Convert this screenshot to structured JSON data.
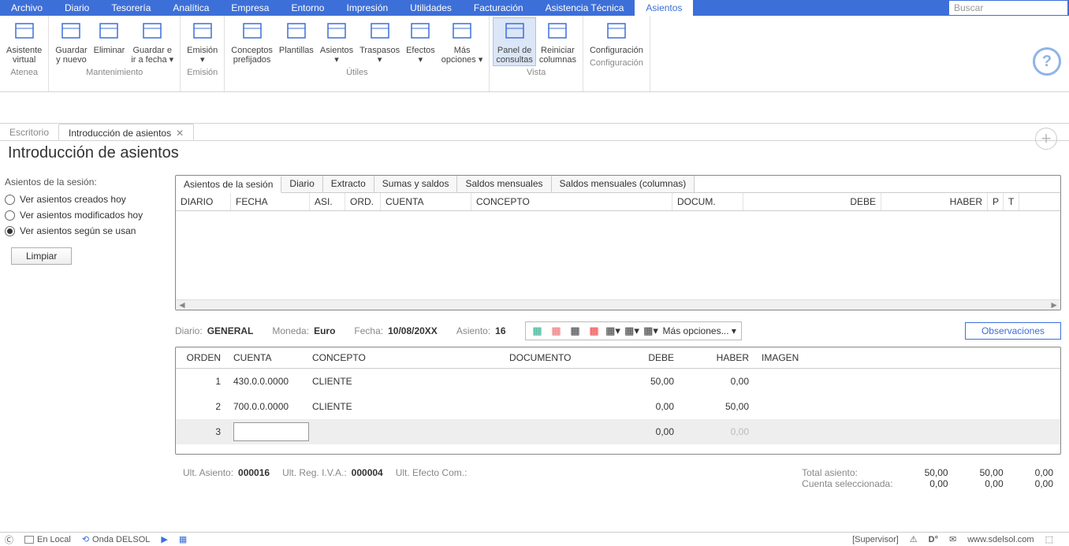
{
  "menu": {
    "items": [
      "Archivo",
      "Diario",
      "Tesorería",
      "Analítica",
      "Empresa",
      "Entorno",
      "Impresión",
      "Utilidades",
      "Facturación",
      "Asistencia Técnica",
      "Asientos"
    ],
    "active": 10,
    "search_placeholder": "Buscar"
  },
  "ribbon": {
    "groups": [
      {
        "label": "Atenea",
        "buttons": [
          {
            "lbl": "Asistente\nvirtual",
            "name": "asistente-virtual"
          }
        ]
      },
      {
        "label": "Mantenimiento",
        "buttons": [
          {
            "lbl": "Guardar\ny nuevo",
            "name": "guardar-y-nuevo"
          },
          {
            "lbl": "Eliminar",
            "name": "eliminar"
          },
          {
            "lbl": "Guardar e\nir a fecha ▾",
            "name": "guardar-ir-a-fecha"
          }
        ]
      },
      {
        "label": "Emisión",
        "buttons": [
          {
            "lbl": "Emisión\n▾",
            "name": "emision"
          }
        ]
      },
      {
        "label": "Útiles",
        "buttons": [
          {
            "lbl": "Conceptos\nprefijados",
            "name": "conceptos-prefijados"
          },
          {
            "lbl": "Plantillas",
            "name": "plantillas"
          },
          {
            "lbl": "Asientos\n▾",
            "name": "asientos"
          },
          {
            "lbl": "Traspasos\n▾",
            "name": "traspasos"
          },
          {
            "lbl": "Efectos\n▾",
            "name": "efectos"
          },
          {
            "lbl": "Más\nopciones ▾",
            "name": "mas-opciones"
          }
        ]
      },
      {
        "label": "Vista",
        "buttons": [
          {
            "lbl": "Panel de\nconsultas",
            "name": "panel-de-consultas",
            "active": true
          },
          {
            "lbl": "Reiniciar\ncolumnas",
            "name": "reiniciar-columnas"
          }
        ]
      },
      {
        "label": "Configuración",
        "buttons": [
          {
            "lbl": "Configuración",
            "name": "configuracion"
          }
        ]
      }
    ]
  },
  "workspace": {
    "tabs": [
      {
        "label": "Escritorio",
        "closable": false,
        "active": false
      },
      {
        "label": "Introducción de asientos",
        "closable": true,
        "active": true
      }
    ],
    "title": "Introducción de asientos"
  },
  "sidebar": {
    "heading": "Asientos de la sesión:",
    "radios": [
      {
        "label": "Ver asientos creados hoy",
        "checked": false
      },
      {
        "label": "Ver asientos modificados hoy",
        "checked": false
      },
      {
        "label": "Ver asientos según se usan",
        "checked": true
      }
    ],
    "clear_label": "Limpiar"
  },
  "subtabs": {
    "items": [
      "Asientos de la sesión",
      "Diario",
      "Extracto",
      "Sumas y saldos",
      "Saldos mensuales",
      "Saldos mensuales (columnas)"
    ],
    "active": 0
  },
  "upper_table": {
    "headers": [
      "DIARIO",
      "FECHA",
      "ASI.",
      "ORD.",
      "CUENTA",
      "CONCEPTO",
      "DOCUM.",
      "DEBE",
      "HABER",
      "P",
      "T"
    ]
  },
  "info": {
    "diario_k": "Diario:",
    "diario_v": "GENERAL",
    "moneda_k": "Moneda:",
    "moneda_v": "Euro",
    "fecha_k": "Fecha:",
    "fecha_v": "10/08/20XX",
    "asiento_k": "Asiento:",
    "asiento_v": "16",
    "mas_opciones": "Más opciones...  ▾",
    "observaciones": "Observaciones"
  },
  "entry_table": {
    "headers": [
      "ORDEN",
      "CUENTA",
      "CONCEPTO",
      "DOCUMENTO",
      "DEBE",
      "HABER",
      "IMAGEN"
    ],
    "rows": [
      {
        "orden": "1",
        "cuenta": "430.0.0.0000",
        "concepto": "CLIENTE",
        "documento": "",
        "debe": "50,00",
        "haber": "0,00",
        "imagen": ""
      },
      {
        "orden": "2",
        "cuenta": "700.0.0.0000",
        "concepto": "CLIENTE",
        "documento": "",
        "debe": "0,00",
        "haber": "50,00",
        "imagen": ""
      },
      {
        "orden": "3",
        "cuenta": "",
        "concepto": "",
        "documento": "",
        "debe": "0,00",
        "haber": "0,00",
        "imagen": "",
        "editing": true
      }
    ]
  },
  "totals": {
    "ult_asiento_k": "Ult. Asiento:",
    "ult_asiento_v": "000016",
    "ult_reg_iva_k": "Ult. Reg. I.V.A.:",
    "ult_reg_iva_v": "000004",
    "ult_efecto_k": "Ult. Efecto Com.:",
    "total_asiento_k": "Total asiento:",
    "cuenta_sel_k": "Cuenta seleccionada:",
    "col1a": "50,00",
    "col1b": "0,00",
    "col2a": "50,00",
    "col2b": "0,00",
    "col3a": "0,00",
    "col3b": "0,00"
  },
  "status": {
    "en_local": "En Local",
    "onda": "Onda DELSOL",
    "supervisor": "[Supervisor]",
    "url": "www.sdelsol.com"
  }
}
